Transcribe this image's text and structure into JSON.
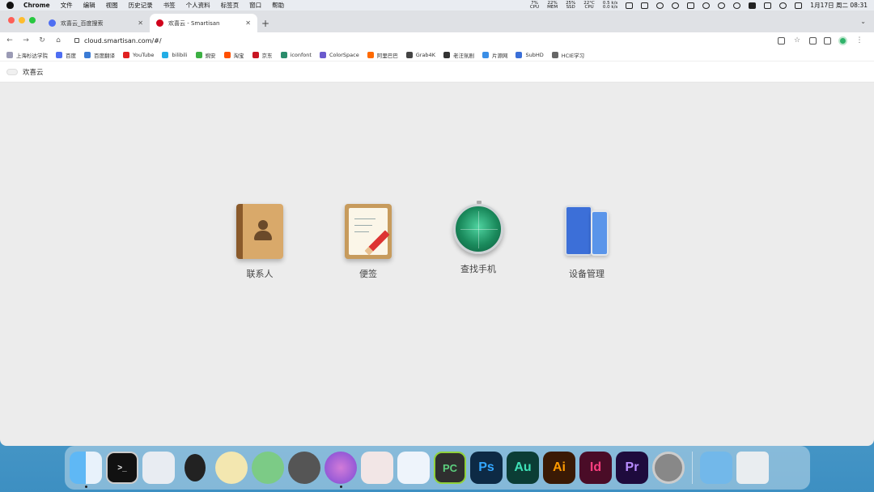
{
  "menubar": {
    "app_name": "Chrome",
    "menus": [
      "文件",
      "编辑",
      "视图",
      "历史记录",
      "书签",
      "个人资料",
      "标签页",
      "窗口",
      "帮助"
    ],
    "stats": [
      {
        "value": "7%",
        "label": "CPU"
      },
      {
        "value": "22%",
        "label": "MEM"
      },
      {
        "value": "25%",
        "label": "SSD"
      },
      {
        "value": "22°C",
        "label": "CPU"
      }
    ],
    "net_up": "0.5 k/s",
    "net_down": "0.0 k/s",
    "datetime": "1月17日 周二  08:31"
  },
  "tabs": [
    {
      "title": "欢喜云_百度搜索",
      "favicon_color": "#4e6ef2",
      "active": false
    },
    {
      "title": "欢喜云 - Smartisan",
      "favicon_color": "#d0021b",
      "active": true
    }
  ],
  "toolbar": {
    "url": "cloud.smartisan.com/#/"
  },
  "bookmarks": [
    {
      "label": "上海杉达学院",
      "color": "#9b9bb5"
    },
    {
      "label": "百度",
      "color": "#4e6ef2"
    },
    {
      "label": "百度翻译",
      "color": "#3a7bd5"
    },
    {
      "label": "YouTube",
      "color": "#e02020"
    },
    {
      "label": "bilibili",
      "color": "#23ade5"
    },
    {
      "label": "豌安",
      "color": "#3cb043"
    },
    {
      "label": "淘宝",
      "color": "#ff5000"
    },
    {
      "label": "京东",
      "color": "#c81623"
    },
    {
      "label": "iconfont",
      "color": "#2a8c6b"
    },
    {
      "label": "ColorSpace",
      "color": "#6a5acd"
    },
    {
      "label": "阿里巴巴",
      "color": "#ff6a00"
    },
    {
      "label": "Grab4K",
      "color": "#444444"
    },
    {
      "label": "老汪氛剧",
      "color": "#333333"
    },
    {
      "label": "片源网",
      "color": "#3a8ee6"
    },
    {
      "label": "SubHD",
      "color": "#3a6fd8"
    },
    {
      "label": "HCIE学习",
      "color": "#666666"
    }
  ],
  "page": {
    "site_name": "欢喜云",
    "apps": [
      {
        "label": "联系人",
        "icon": "contacts-icon"
      },
      {
        "label": "便签",
        "icon": "notes-icon"
      },
      {
        "label": "查找手机",
        "icon": "find-phone-icon"
      },
      {
        "label": "设备管理",
        "icon": "device-management-icon"
      }
    ]
  },
  "dock": {
    "text_icons": {
      "pycharm": "PC",
      "photoshop": "Ps",
      "audition": "Au",
      "illustrator": "Ai",
      "indesign": "Id",
      "premiere": "Pr"
    }
  }
}
